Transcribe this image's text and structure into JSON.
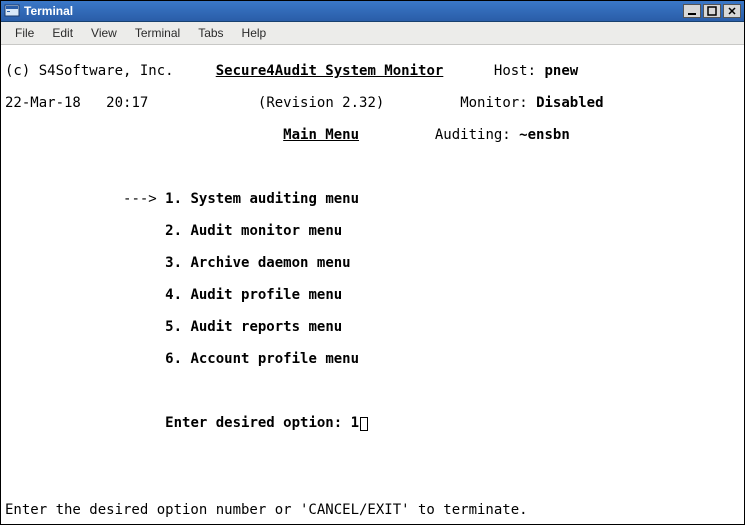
{
  "window": {
    "title": "Terminal"
  },
  "menubar": {
    "items": [
      "File",
      "Edit",
      "View",
      "Terminal",
      "Tabs",
      "Help"
    ]
  },
  "header": {
    "copyright": "(c) S4Software, Inc.",
    "app_title": "Secure4Audit System Monitor",
    "host_label": "Host:",
    "host_value": "pnew",
    "date": "22-Mar-18",
    "time": "20:17",
    "revision": "(Revision 2.32)",
    "monitor_label": "Monitor:",
    "monitor_value": "Disabled",
    "screen_title": "Main Menu",
    "auditing_label": "Auditing:",
    "auditing_value": "~ensbn"
  },
  "menu": {
    "pointer": "--->",
    "items": [
      {
        "num": "1.",
        "label": "System auditing menu"
      },
      {
        "num": "2.",
        "label": "Audit monitor menu"
      },
      {
        "num": "3.",
        "label": "Archive daemon menu"
      },
      {
        "num": "4.",
        "label": "Audit profile menu"
      },
      {
        "num": "5.",
        "label": "Audit reports menu"
      },
      {
        "num": "6.",
        "label": "Account profile menu"
      }
    ],
    "prompt": "Enter desired option:",
    "input_value": "1"
  },
  "footer": {
    "hint": "Enter the desired option number or 'CANCEL/EXIT' to terminate."
  }
}
